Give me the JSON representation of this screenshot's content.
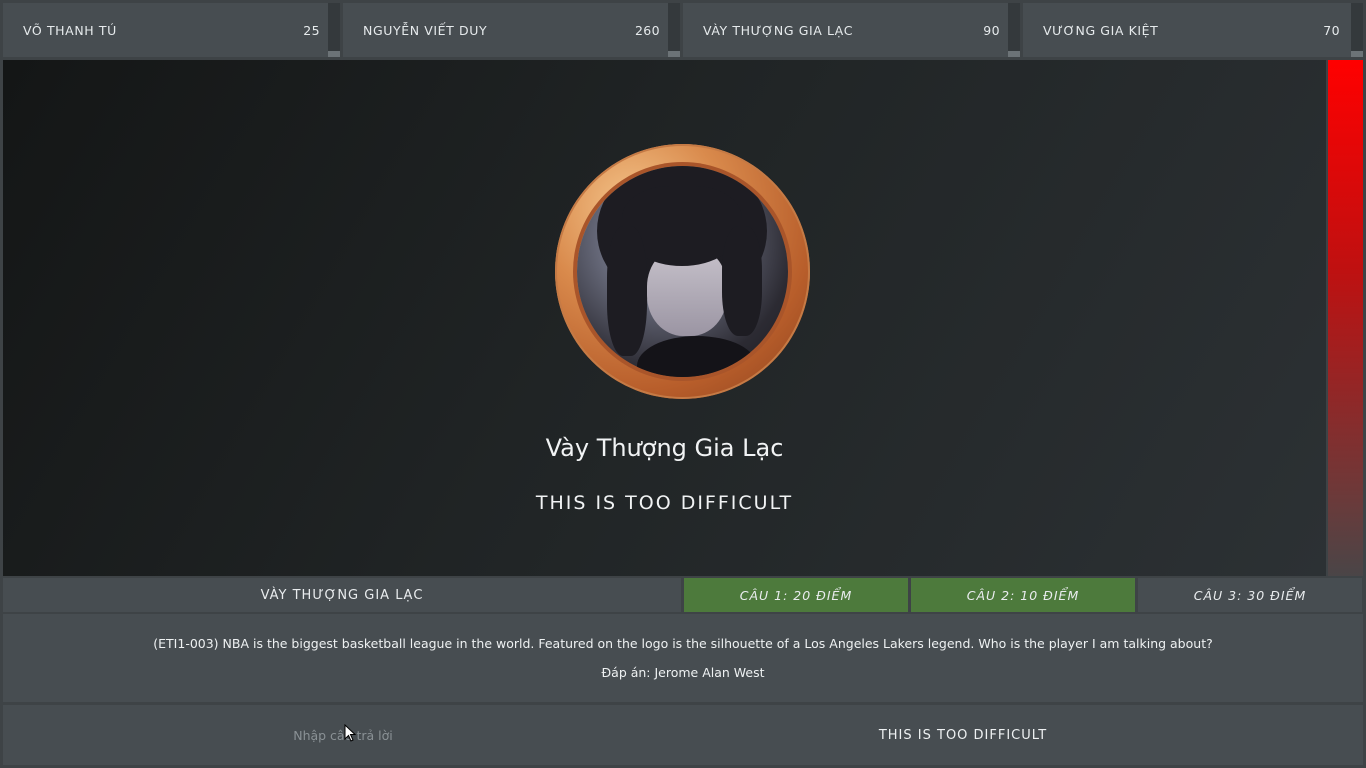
{
  "scoreboard": [
    {
      "name": "VÕ THANH TÚ",
      "score": "25"
    },
    {
      "name": "NGUYỄN VIẾT DUY",
      "score": "260"
    },
    {
      "name": "VÀY THƯỢNG GIA LẠC",
      "score": "90"
    },
    {
      "name": "VƯƠNG GIA KIỆT",
      "score": "70"
    }
  ],
  "stage": {
    "player_name": "Vày Thượng Gia Lạc",
    "player_answer": "THIS IS TOO DIFFICULT",
    "avatar_icon": "player-avatar"
  },
  "timer": {
    "remaining_fraction": 1.0,
    "color": "#ff0000"
  },
  "question_bar": {
    "current_player": "VÀY THƯỢNG GIA LẠC",
    "tabs": [
      {
        "label": "CÂU 1: 20 ĐIỂM",
        "status": "answered"
      },
      {
        "label": "CÂU 2: 10 ĐIỂM",
        "status": "answered"
      },
      {
        "label": "CÂU 3: 30 ĐIỂM",
        "status": "pending"
      }
    ],
    "answered_color": "#4d7a3c"
  },
  "question": {
    "text": "(ETI1-003) NBA is the biggest basketball league in the world. Featured on the logo is the silhouette of a Los Angeles Lakers legend. Who is the player I am talking about?",
    "answer": "Đáp án: Jerome Alan West"
  },
  "input": {
    "placeholder": "Nhập câu trả lời",
    "value": "",
    "submitted_answer": "THIS IS TOO DIFFICULT"
  }
}
